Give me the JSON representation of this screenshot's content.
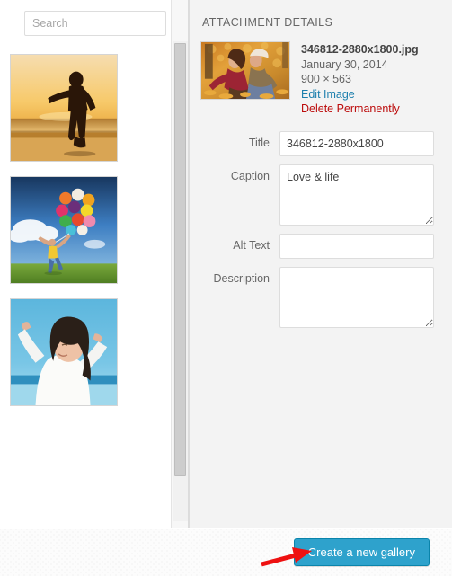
{
  "search": {
    "placeholder": "Search",
    "value": ""
  },
  "media_library": {
    "items": [
      {
        "name": "beach-sunset-silhouette",
        "alt": "Woman silhouette dancing on beach at sunset"
      },
      {
        "name": "girl-with-balloons",
        "alt": "Girl jumping in a green field holding colorful balloons"
      },
      {
        "name": "woman-arms-raised",
        "alt": "Smiling woman with arms raised against a blue sky"
      }
    ]
  },
  "details": {
    "heading": "ATTACHMENT DETAILS",
    "filename": "346812-2880x1800.jpg",
    "date": "January 30, 2014",
    "dimensions": "900 × 563",
    "edit_image_label": "Edit Image",
    "delete_label": "Delete Permanently",
    "thumb_alt": "Couple sitting among autumn leaves",
    "fields": {
      "title_label": "Title",
      "title_value": "346812-2880x1800",
      "caption_label": "Caption",
      "caption_value": "Love & life",
      "alt_text_label": "Alt Text",
      "alt_text_value": "",
      "description_label": "Description",
      "description_value": ""
    }
  },
  "footer": {
    "create_gallery_label": "Create a new gallery"
  },
  "annotation": {
    "arrow_color": "#ee1111",
    "points_to": "create-a-new-gallery-button"
  },
  "colors": {
    "accent_blue": "#2ea2cc",
    "link_blue": "#1d7fad",
    "danger_red": "#bc0b0b",
    "sidebar_bg": "#f3f3f3"
  }
}
